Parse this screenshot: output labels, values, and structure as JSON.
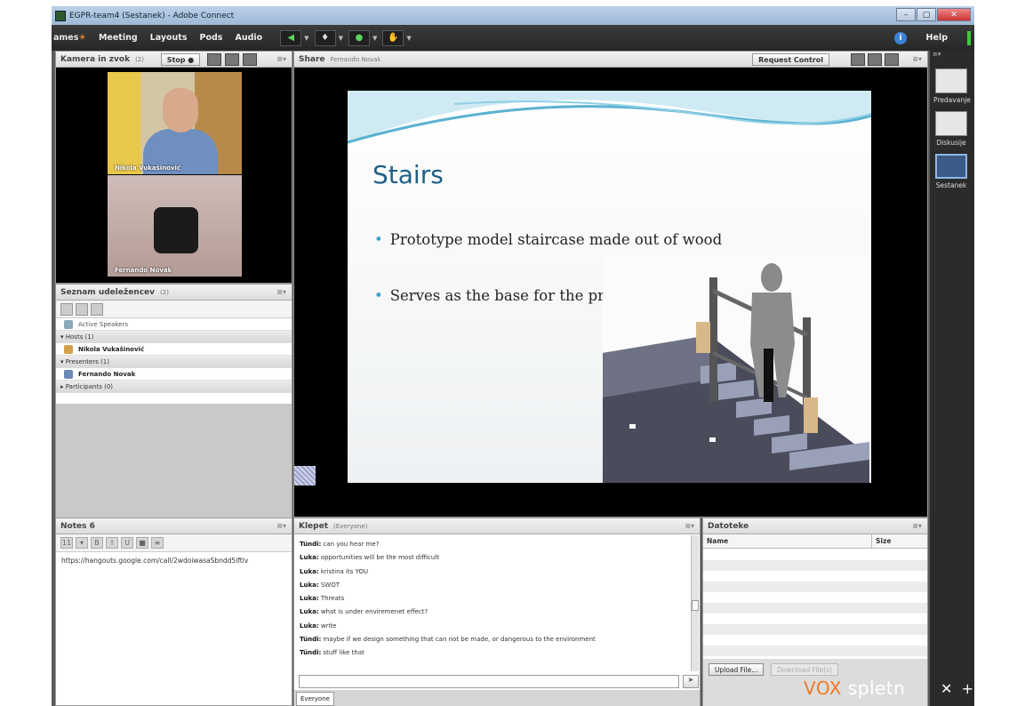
{
  "window": {
    "title": "EGPR-team4 (Sestanek) - Adobe Connect",
    "controls": [
      "–",
      "▢",
      "✕"
    ]
  },
  "menubar": {
    "brand_prefix": "ames",
    "items": [
      "Meeting",
      "Layouts",
      "Pods",
      "Audio"
    ],
    "help": "Help"
  },
  "camera_pod": {
    "title": "Kamera in zvok",
    "count": "(2)",
    "stop_label": "Stop",
    "video1_name": "Nikola Vukašinović",
    "video2_name": "Fernando Novak"
  },
  "attendees_pod": {
    "title": "Seznam udeležencev",
    "count": "(2)",
    "active_speakers": "Active Speakers",
    "hosts_label": "Hosts (1)",
    "host_name": "Nikola Vukašinović",
    "presenters_label": "Presenters (1)",
    "presenter_name": "Fernando Novak",
    "participants_label": "Participants (0)"
  },
  "share_pod": {
    "title": "Share",
    "sharer": "Fernando Novak",
    "request_control": "Request Control",
    "slide": {
      "title": "Stairs",
      "bullets": [
        "Prototype model staircase made out of wood",
        "Serves as the base for the prototype"
      ]
    }
  },
  "layouts_panel": {
    "items": [
      {
        "label": "Predavanje",
        "selected": false
      },
      {
        "label": "Diskusije",
        "selected": false
      },
      {
        "label": "Sestanek",
        "selected": true
      }
    ]
  },
  "notes_pod": {
    "title": "Notes 6",
    "content": "https://hangouts.google.com/call/2wdoiwasaSbndd5iftlv"
  },
  "chat_pod": {
    "title": "Klepet",
    "scope": "(Everyone)",
    "messages": [
      {
        "sender": "Tündi:",
        "text": "can you hear me?"
      },
      {
        "sender": "Luka:",
        "text": "opportunities will be the most difficult"
      },
      {
        "sender": "Luka:",
        "text": "kristina its YOU"
      },
      {
        "sender": "Luka:",
        "text": "SWOT"
      },
      {
        "sender": "Luka:",
        "text": "Threats"
      },
      {
        "sender": "Luka:",
        "text": "what is under enviremenet effect?"
      },
      {
        "sender": "Luka:",
        "text": "write"
      },
      {
        "sender": "Tündi:",
        "text": "maybe if we design something that can not be made, or dangerous to the environment"
      },
      {
        "sender": "Tündi:",
        "text": "stuff like that"
      }
    ],
    "tab": "Everyone"
  },
  "files_pod": {
    "title": "Datoteke",
    "col_name": "Name",
    "col_size": "Size",
    "upload_label": "Upload File...",
    "download_label": "Download File(s)"
  },
  "watermark": {
    "vox": "VOX",
    "spletni": "spletn",
    "close": "✕",
    "plus": "+"
  },
  "colors": {
    "menubar": "#2c2c2c",
    "slide_title": "#1f5f86",
    "bullet": "#3aa0c8",
    "brand_accent": "#f39a2c"
  }
}
